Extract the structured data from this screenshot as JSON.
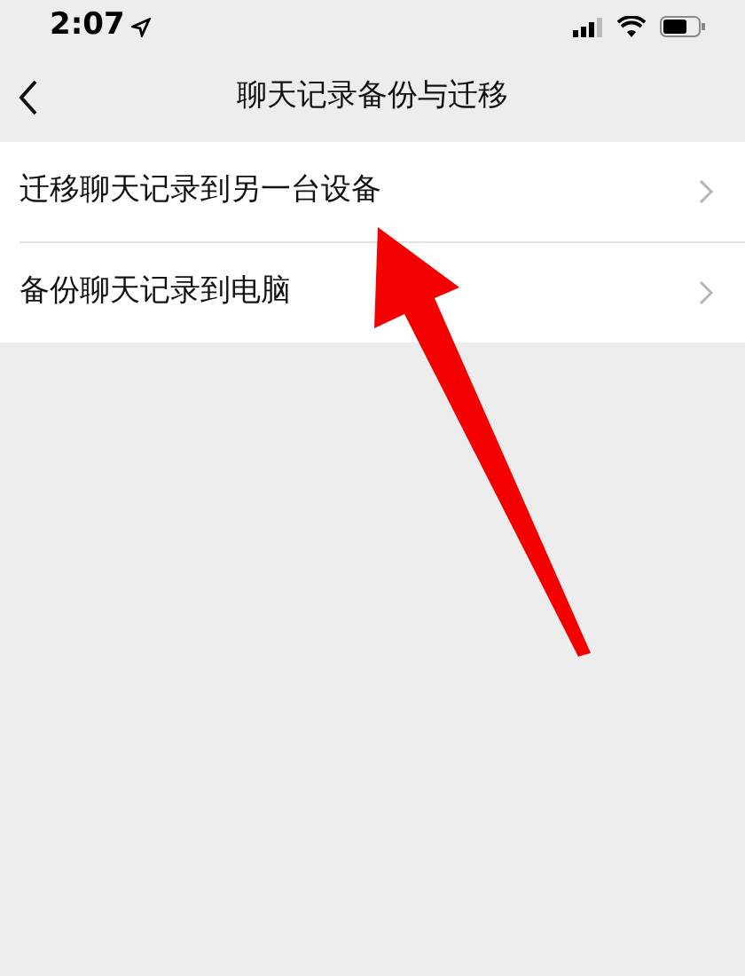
{
  "status_bar": {
    "time": "2:07"
  },
  "nav_bar": {
    "title": "聊天记录备份与迁移"
  },
  "menu_items": [
    {
      "label": "迁移聊天记录到另一台设备"
    },
    {
      "label": "备份聊天记录到电脑"
    }
  ]
}
